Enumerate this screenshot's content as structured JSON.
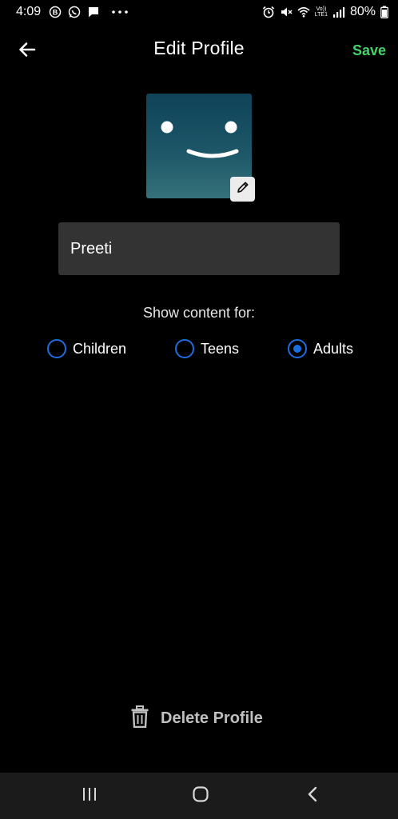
{
  "status_bar": {
    "time": "4:09",
    "volte_label": "Vo))",
    "lte_label": "LTE1",
    "battery": "80%",
    "icons": [
      "whatsapp-business-icon",
      "whatsapp-icon",
      "message-icon",
      "more-dots-icon",
      "alarm-icon",
      "mute-icon",
      "wifi-icon",
      "signal-icon",
      "battery-icon"
    ]
  },
  "header": {
    "title": "Edit Profile",
    "save_label": "Save",
    "back_icon": "arrow-left-icon"
  },
  "avatar": {
    "edit_icon": "pencil-icon"
  },
  "profile": {
    "name_value": "Preeti"
  },
  "content_rating": {
    "label": "Show content for:",
    "options": [
      {
        "label": "Children",
        "selected": false
      },
      {
        "label": "Teens",
        "selected": false
      },
      {
        "label": "Adults",
        "selected": true
      }
    ]
  },
  "delete": {
    "label": "Delete Profile",
    "icon": "trash-icon"
  },
  "nav": {
    "icons": [
      "recent-apps-icon",
      "home-icon",
      "back-icon"
    ]
  },
  "colors": {
    "accent_green": "#46d369",
    "radio_blue": "#1a6fe0",
    "background": "#000000",
    "field_bg": "#333333"
  }
}
